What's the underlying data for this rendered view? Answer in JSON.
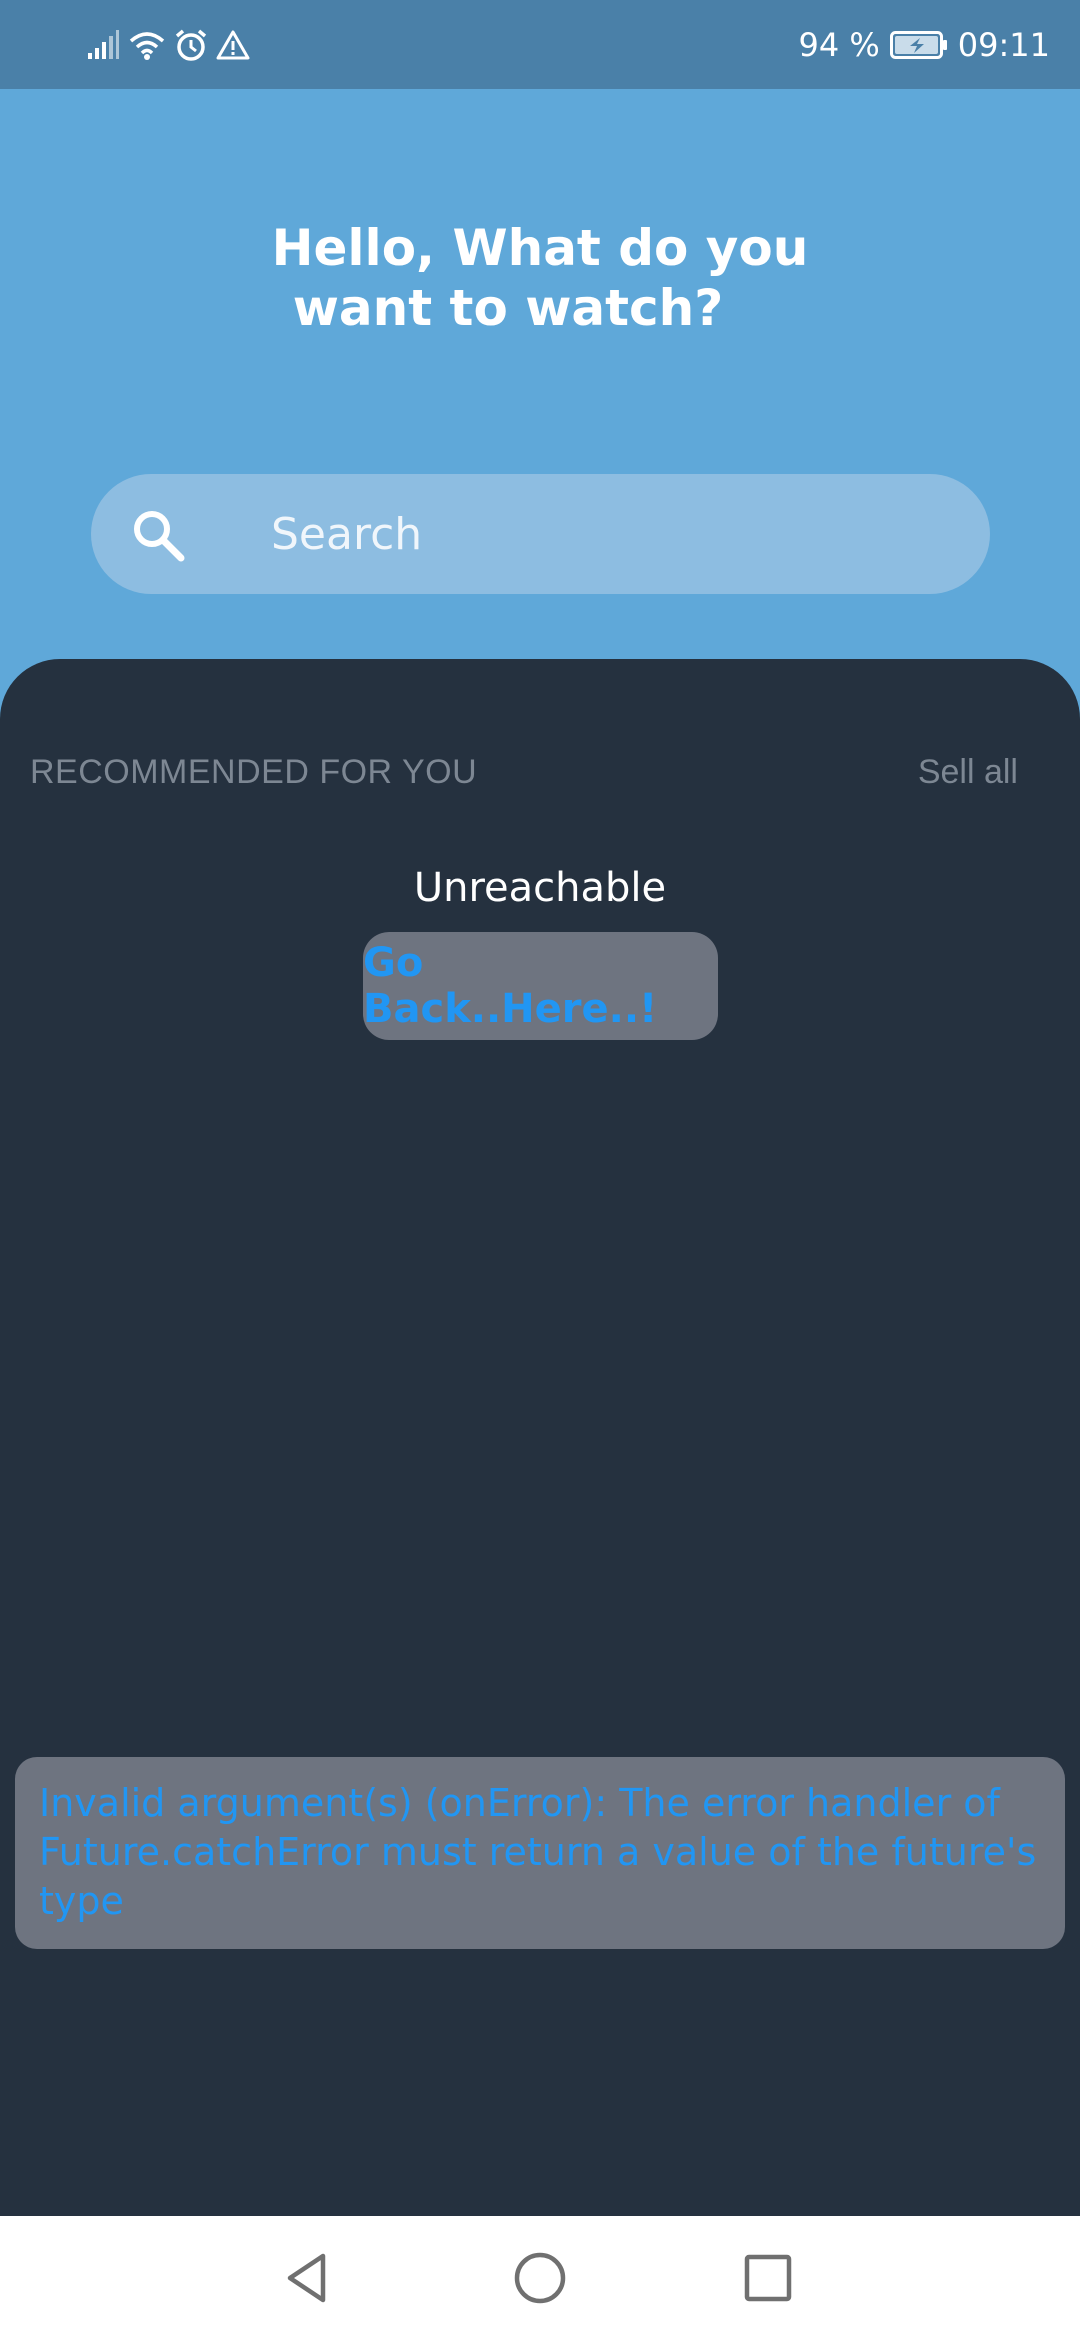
{
  "status_bar": {
    "battery_percent": "94 %",
    "time": "09:11",
    "icons": [
      "signal-icon",
      "wifi-icon",
      "alarm-icon",
      "warning-icon",
      "battery-charging-icon"
    ]
  },
  "header": {
    "greeting_line1": "Hello, What do you",
    "greeting_line2": "want to watch?"
  },
  "search": {
    "placeholder": "Search",
    "icon": "search-icon"
  },
  "section": {
    "title": "RECOMMENDED FOR YOU",
    "see_all_label": "Sell all"
  },
  "error_state": {
    "message": "Unreachable",
    "button_label": "Go Back..Here..!"
  },
  "snackbar": {
    "text": "Invalid argument(s) (onError): The error handler of Future.catchError must return a value of the future's type"
  },
  "colors": {
    "status_bar": "#4a80a8",
    "header": "#5fa8d9",
    "panel": "#25313f",
    "accent": "#2196f3",
    "button_bg": "#6e7480"
  },
  "nav_bar": {
    "buttons": [
      "back-icon",
      "home-icon",
      "recents-icon"
    ]
  }
}
